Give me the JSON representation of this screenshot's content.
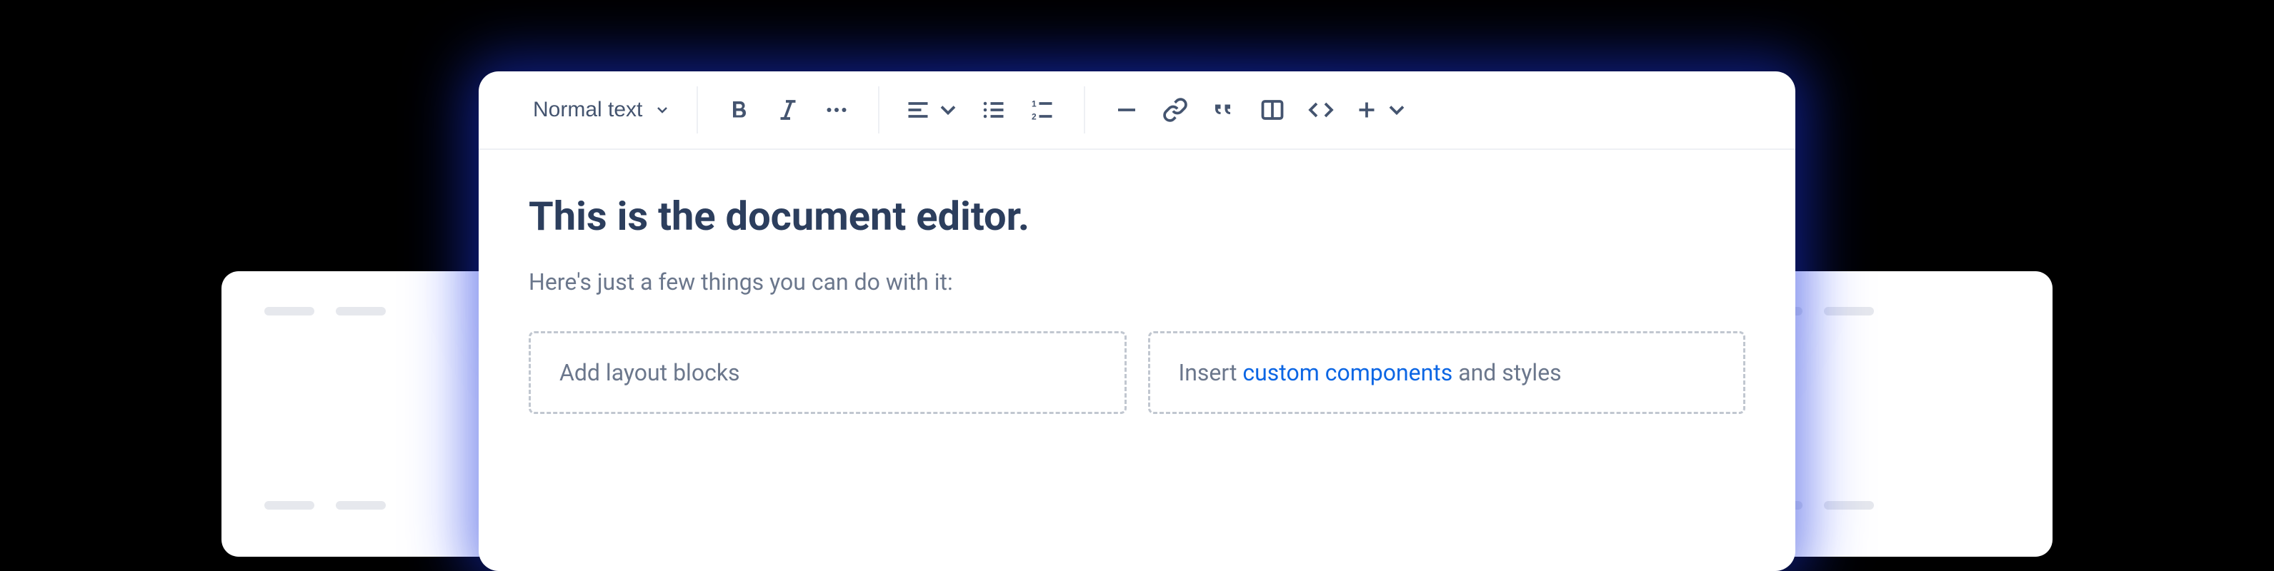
{
  "toolbar": {
    "textStyle": "Normal text"
  },
  "document": {
    "heading": "This is the document editor.",
    "subtext": "Here's just a few things you can do with it:",
    "blocks": {
      "left": "Add layout blocks",
      "right": {
        "prefix": "Insert ",
        "link": "custom components",
        "suffix": " and styles"
      }
    }
  }
}
